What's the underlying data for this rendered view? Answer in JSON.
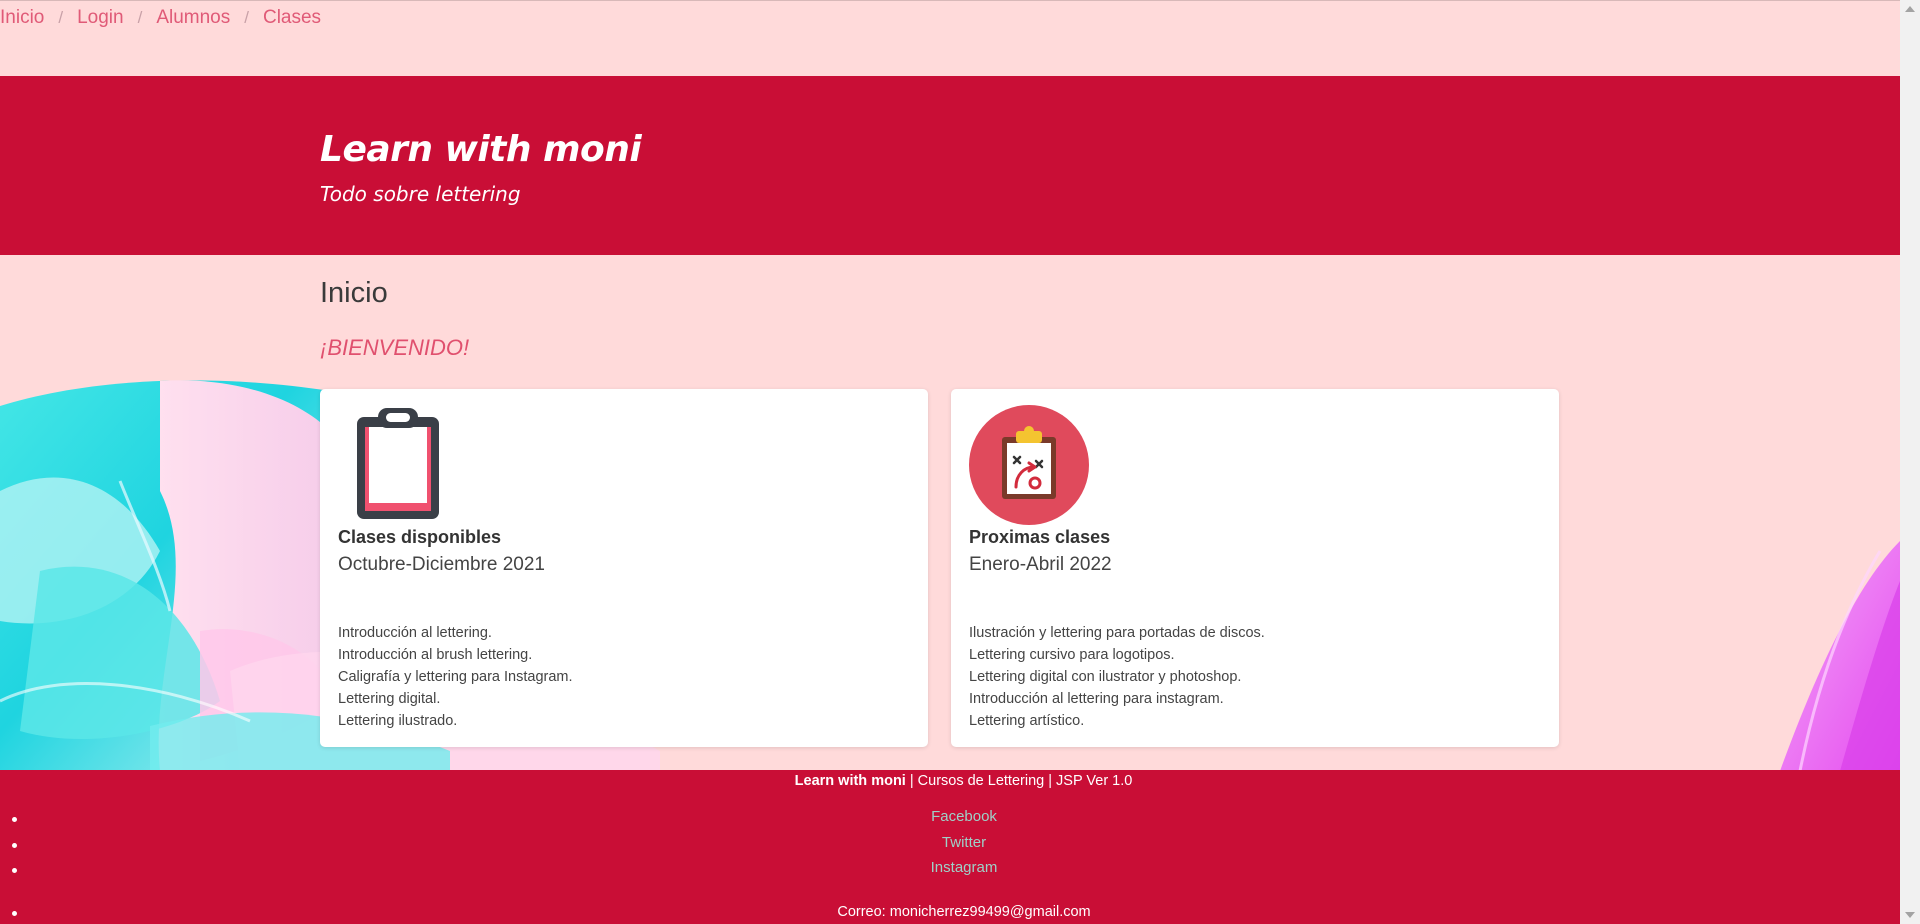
{
  "breadcrumb": {
    "items": [
      "Inicio",
      "Login",
      "Alumnos",
      "Clases"
    ],
    "separator": "/"
  },
  "header": {
    "title": "Learn with moni",
    "subtitle": "Todo sobre lettering",
    "background_color": "#c90e36"
  },
  "main": {
    "heading": "Inicio",
    "welcome": "¡BIENVENIDO!",
    "cards": [
      {
        "icon": "clipboard-icon",
        "title": "Clases disponibles",
        "subtitle": "Octubre-Diciembre 2021",
        "items": [
          "Introducción al lettering.",
          "Introducción al brush lettering.",
          "Caligrafía y lettering para Instagram.",
          "Lettering digital.",
          "Lettering ilustrado."
        ]
      },
      {
        "icon": "strategy-clipboard-icon",
        "title": "Proximas clases",
        "subtitle": "Enero-Abril 2022",
        "items": [
          "Ilustración y lettering para portadas de discos.",
          "Lettering cursivo para logotipos.",
          "Lettering digital con ilustrator y photoshop.",
          "Introducción al lettering para instagram.",
          "Lettering artístico."
        ]
      }
    ]
  },
  "footer": {
    "brand": "Learn with moni",
    "tagline": " | Cursos de Lettering | JSP Ver 1.0",
    "links": [
      "Facebook",
      "Twitter",
      "Instagram"
    ],
    "email": "Correo: monicherrez99499@gmail.com",
    "link_color": "#9fd0c8"
  },
  "colors": {
    "page_background": "#ffdada",
    "accent": "#c90e36",
    "link": "#e05a77"
  }
}
